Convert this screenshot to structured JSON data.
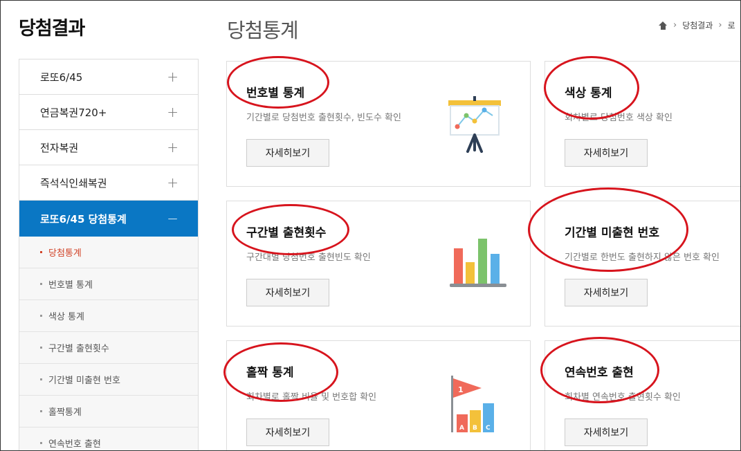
{
  "sidebar": {
    "title": "당첨결과",
    "menu": [
      {
        "label": "로또6/45",
        "toggle": "+"
      },
      {
        "label": "연금복권720+",
        "toggle": "+"
      },
      {
        "label": "전자복권",
        "toggle": "+"
      },
      {
        "label": "즉석식인쇄복권",
        "toggle": "+"
      },
      {
        "label": "로또6/45 당첨통계",
        "toggle": "−"
      }
    ],
    "submenu": [
      {
        "label": "당첨통계"
      },
      {
        "label": "번호별 통계"
      },
      {
        "label": "색상 통계"
      },
      {
        "label": "구간별 출현횟수"
      },
      {
        "label": "기간별 미출현 번호"
      },
      {
        "label": "홀짝통계"
      },
      {
        "label": "연속번호 출현"
      }
    ]
  },
  "main": {
    "title": "당첨통계",
    "breadcrumb": [
      "당첨결과",
      "로"
    ],
    "cards": [
      {
        "title": "번호별 통계",
        "desc": "기간별로 당첨번호 출현횟수, 빈도수 확인",
        "button": "자세히보기",
        "icon": "presentation-chart-icon"
      },
      {
        "title": "색상 통계",
        "desc": "회차별로 당첨번호 색상 확인",
        "button": "자세히보기"
      },
      {
        "title": "구간별 출현횟수",
        "desc": "구간대별 당첨번호 출현빈도 확인",
        "button": "자세히보기",
        "icon": "bar-chart-icon"
      },
      {
        "title": "기간별 미출현 번호",
        "desc": "기간별로 한번도 출현하지 않은 번호 확인",
        "button": "자세히보기"
      },
      {
        "title": "홀짝 통계",
        "desc": "회차별로 홀짝 비율 및 번호합 확인",
        "button": "자세히보기",
        "icon": "flag-abc-chart-icon"
      },
      {
        "title": "연속번호 출현",
        "desc": "회차별 연속번호 출현횟수 확인",
        "button": "자세히보기"
      }
    ]
  },
  "colors": {
    "accent": "#0a77c4",
    "active_sub": "#d2452a",
    "annotation": "#d7141d"
  }
}
